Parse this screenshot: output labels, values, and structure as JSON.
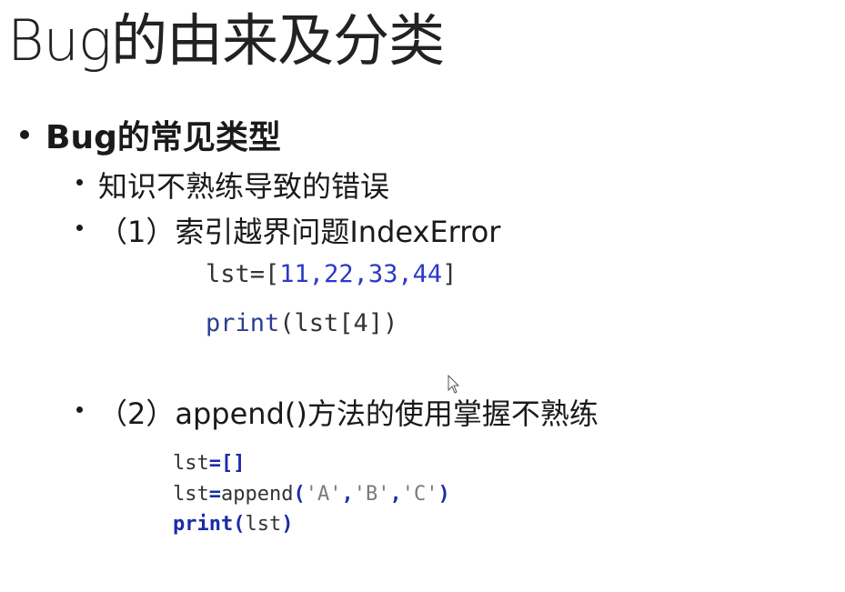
{
  "slide": {
    "title": "Bug的由来及分类",
    "section_heading": "Bug的常见类型",
    "items": [
      "知识不熟练导致的错误",
      "（1）索引越界问题IndexError",
      "（2）append()方法的使用掌握不熟练"
    ]
  },
  "code_block_1": {
    "line1": {
      "prefix": "lst=",
      "open": "[",
      "values": "11,22,33,44",
      "close": "]"
    },
    "line2": {
      "func": "print",
      "args": "(lst[4])"
    }
  },
  "code_block_2": {
    "line1": {
      "name": "lst",
      "op": "=[]"
    },
    "line2": {
      "name": "lst",
      "op": "=",
      "call": "append",
      "open": "(",
      "s1": "'A'",
      "c1": ",",
      "s2": "'B'",
      "c2": ",",
      "s3": "'C'",
      "close": ")"
    },
    "line3": {
      "func": "print",
      "open": "(",
      "arg": "lst",
      "close": ")"
    }
  },
  "colors": {
    "number_blue": "#2b39c8",
    "keyword_blue": "#1b2ba8",
    "string_gray": "#7a7a7a"
  },
  "icons": {
    "cursor": "mouse-pointer-icon"
  }
}
